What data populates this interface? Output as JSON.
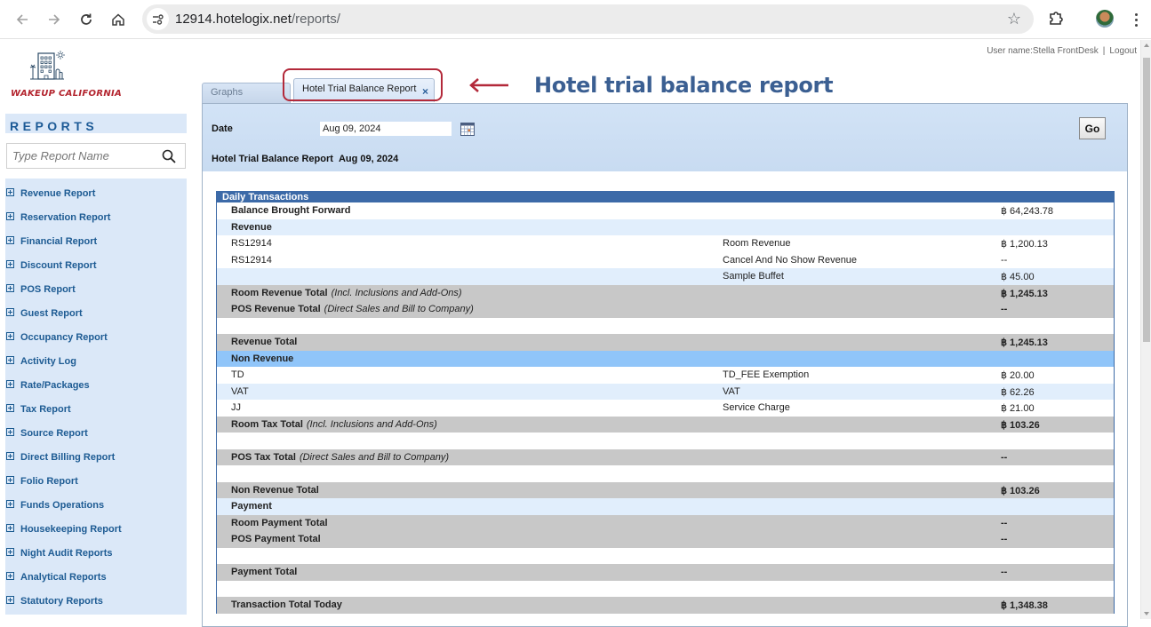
{
  "browser": {
    "url_host": "12914.hotelogix.net",
    "url_path": "/reports/"
  },
  "brand": {
    "name": "WAKEUP CALIFORNIA"
  },
  "user": {
    "label": "User name:Stella FrontDesk",
    "separator": "|",
    "logout": "Logout"
  },
  "sidebar": {
    "heading": "REPORTS",
    "search_placeholder": "Type Report Name",
    "items": [
      {
        "label": "Revenue Report"
      },
      {
        "label": "Reservation Report"
      },
      {
        "label": "Financial Report"
      },
      {
        "label": "Discount Report"
      },
      {
        "label": "POS Report"
      },
      {
        "label": "Guest Report"
      },
      {
        "label": "Occupancy Report"
      },
      {
        "label": "Activity Log"
      },
      {
        "label": "Rate/Packages"
      },
      {
        "label": "Tax Report"
      },
      {
        "label": "Source Report"
      },
      {
        "label": "Direct Billing Report"
      },
      {
        "label": "Folio Report"
      },
      {
        "label": "Funds Operations"
      },
      {
        "label": "Housekeeping Report"
      },
      {
        "label": "Night Audit Reports"
      },
      {
        "label": "Analytical Reports"
      },
      {
        "label": "Statutory Reports"
      }
    ]
  },
  "tabs": {
    "graphs": "Graphs",
    "active": "Hotel Trial Balance Report",
    "close": "×"
  },
  "annotation": {
    "text": "Hotel trial balance report",
    "color": "#b3293a"
  },
  "filters": {
    "date_label": "Date",
    "date_value": "Aug 09, 2024",
    "go_label": "Go"
  },
  "report": {
    "title": "Hotel Trial Balance Report",
    "date": "Aug 09, 2024",
    "section_header": "Daily Transactions",
    "currency_symbol": "฿",
    "rows": [
      {
        "style": "white",
        "bold": true,
        "c1": "Balance Brought Forward",
        "note": "",
        "c2": "",
        "c3": "฿ 64,243.78",
        "c3_bold": false
      },
      {
        "style": "light",
        "bold": true,
        "c1": "Revenue",
        "note": "",
        "c2": "",
        "c3": ""
      },
      {
        "style": "white",
        "bold": false,
        "c1": "RS12914",
        "note": "",
        "c2": "Room Revenue",
        "c3": "฿ 1,200.13"
      },
      {
        "style": "white",
        "bold": false,
        "c1": "RS12914",
        "note": "",
        "c2": "Cancel And No Show Revenue",
        "c3": "--"
      },
      {
        "style": "light",
        "bold": false,
        "c1": "",
        "note": "",
        "c2": "Sample Buffet",
        "c3": "฿ 45.00"
      },
      {
        "style": "grey",
        "bold": true,
        "c1": "Room Revenue Total",
        "note": "(Incl. Inclusions and Add-Ons)",
        "c2": "",
        "c3": "฿ 1,245.13"
      },
      {
        "style": "grey",
        "bold": true,
        "c1": "POS Revenue Total",
        "note": "(Direct Sales and Bill to Company)",
        "c2": "",
        "c3": "--"
      },
      {
        "style": "white",
        "bold": false,
        "c1": "",
        "note": "",
        "c2": "",
        "c3": ""
      },
      {
        "style": "grey",
        "bold": true,
        "c1": "Revenue Total",
        "note": "",
        "c2": "",
        "c3": "฿ 1,245.13"
      },
      {
        "style": "blue",
        "bold": true,
        "c1": "Non Revenue",
        "note": "",
        "c2": "",
        "c3": ""
      },
      {
        "style": "white",
        "bold": false,
        "c1": "TD",
        "note": "",
        "c2": "TD_FEE Exemption",
        "c3": "฿ 20.00"
      },
      {
        "style": "light",
        "bold": false,
        "c1": "VAT",
        "note": "",
        "c2": "VAT",
        "c3": "฿ 62.26"
      },
      {
        "style": "white",
        "bold": false,
        "c1": "JJ",
        "note": "",
        "c2": "Service Charge",
        "c3": "฿ 21.00"
      },
      {
        "style": "grey",
        "bold": true,
        "c1": "Room Tax Total",
        "note": "(Incl. Inclusions and Add-Ons)",
        "c2": "",
        "c3": "฿ 103.26"
      },
      {
        "style": "white",
        "bold": false,
        "c1": "",
        "note": "",
        "c2": "",
        "c3": ""
      },
      {
        "style": "grey",
        "bold": true,
        "c1": "POS Tax Total",
        "note": "(Direct Sales and Bill to Company)",
        "c2": "",
        "c3": "--"
      },
      {
        "style": "white",
        "bold": false,
        "c1": "",
        "note": "",
        "c2": "",
        "c3": ""
      },
      {
        "style": "grey",
        "bold": true,
        "c1": "Non Revenue Total",
        "note": "",
        "c2": "",
        "c3": "฿ 103.26"
      },
      {
        "style": "light",
        "bold": true,
        "c1": "Payment",
        "note": "",
        "c2": "",
        "c3": ""
      },
      {
        "style": "grey",
        "bold": true,
        "c1": "Room Payment Total",
        "note": "",
        "c2": "",
        "c3": "--"
      },
      {
        "style": "grey",
        "bold": true,
        "c1": "POS Payment Total",
        "note": "",
        "c2": "",
        "c3": "--"
      },
      {
        "style": "white",
        "bold": false,
        "c1": "",
        "note": "",
        "c2": "",
        "c3": ""
      },
      {
        "style": "grey",
        "bold": true,
        "c1": "Payment Total",
        "note": "",
        "c2": "",
        "c3": "--"
      },
      {
        "style": "white",
        "bold": false,
        "c1": "",
        "note": "",
        "c2": "",
        "c3": ""
      },
      {
        "style": "grey",
        "bold": true,
        "c1": "Transaction Total Today",
        "note": "",
        "c2": "",
        "c3": "฿ 1,348.38"
      }
    ]
  }
}
